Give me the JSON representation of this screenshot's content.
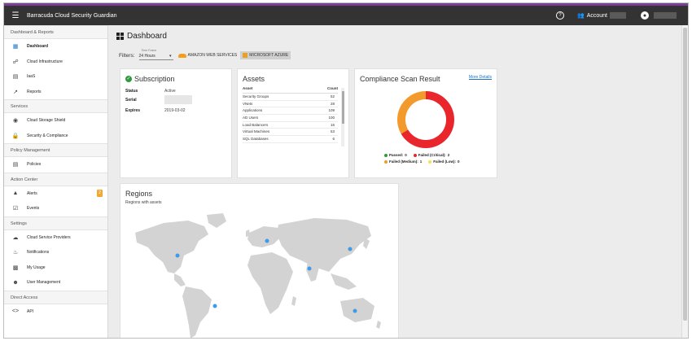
{
  "header": {
    "app_title": "Barracuda Cloud Security Guardian",
    "account_label": "Account"
  },
  "sidebar": {
    "sections": [
      {
        "title": "Dashboard & Reports",
        "items": [
          {
            "label": "Dashboard",
            "icon": "dashboard-icon",
            "active": true
          },
          {
            "label": "Cloud Infrastructure",
            "icon": "network-icon"
          },
          {
            "label": "IaaS",
            "icon": "servers-icon"
          },
          {
            "label": "Reports",
            "icon": "trend-icon"
          }
        ]
      },
      {
        "title": "Services",
        "items": [
          {
            "label": "Cloud Storage Shield",
            "icon": "shield-icon"
          },
          {
            "label": "Security & Compliance",
            "icon": "lock-icon"
          }
        ]
      },
      {
        "title": "Policy Management",
        "items": [
          {
            "label": "Policies",
            "icon": "policy-icon"
          }
        ]
      },
      {
        "title": "Action Center",
        "items": [
          {
            "label": "Alerts",
            "icon": "warning-icon",
            "badge": "2"
          },
          {
            "label": "Events",
            "icon": "events-icon"
          }
        ]
      },
      {
        "title": "Settings",
        "items": [
          {
            "label": "Cloud Service Providers",
            "icon": "cloud-icon"
          },
          {
            "label": "Notifications",
            "icon": "bell-icon"
          },
          {
            "label": "My Usage",
            "icon": "usage-icon"
          },
          {
            "label": "User Management",
            "icon": "users-icon"
          }
        ]
      },
      {
        "title": "Direct Access",
        "items": [
          {
            "label": "API",
            "icon": "code-icon"
          }
        ]
      }
    ]
  },
  "page": {
    "title": "Dashboard",
    "filters_label": "Filters",
    "timeframe_label": "Time Frame",
    "timeframe_value": "24 Hours",
    "aws_label": "AMAZON WEB SERVICES",
    "azure_label": "MICROSOFT AZURE"
  },
  "subscription": {
    "title": "Subscription",
    "rows": [
      {
        "key": "Status",
        "value": "Active"
      },
      {
        "key": "Serial",
        "value": ""
      },
      {
        "key": "Expires",
        "value": "2019-03-02"
      }
    ]
  },
  "assets": {
    "title": "Assets",
    "col_asset": "Asset",
    "col_count": "Count",
    "rows": [
      {
        "name": "Security Groups",
        "count": "52"
      },
      {
        "name": "VNets",
        "count": "28"
      },
      {
        "name": "Applications",
        "count": "109"
      },
      {
        "name": "AD Users",
        "count": "100"
      },
      {
        "name": "Load Balancers",
        "count": "16"
      },
      {
        "name": "Virtual Machines",
        "count": "53"
      },
      {
        "name": "SQL Databases",
        "count": "6"
      }
    ]
  },
  "compliance": {
    "title": "Compliance Scan Result",
    "more_link": "More Details",
    "colors": {
      "passed": "#2e9a3c",
      "critical": "#e8262b",
      "medium": "#f39a2c",
      "low": "#f5e14a"
    },
    "chart_data": {
      "type": "pie",
      "categories": [
        "Passed",
        "Failed (Critical)",
        "Failed (Medium)",
        "Failed (Low)"
      ],
      "values": [
        0,
        2,
        1,
        0
      ]
    },
    "legend": [
      {
        "label": "Passed:",
        "value": "0"
      },
      {
        "label": "Failed (Critical):",
        "value": "2"
      },
      {
        "label": "Failed (Medium):",
        "value": "1"
      },
      {
        "label": "Failed (Low):",
        "value": "0"
      }
    ]
  },
  "regions": {
    "title": "Regions",
    "subtitle": "Regions with assets"
  }
}
